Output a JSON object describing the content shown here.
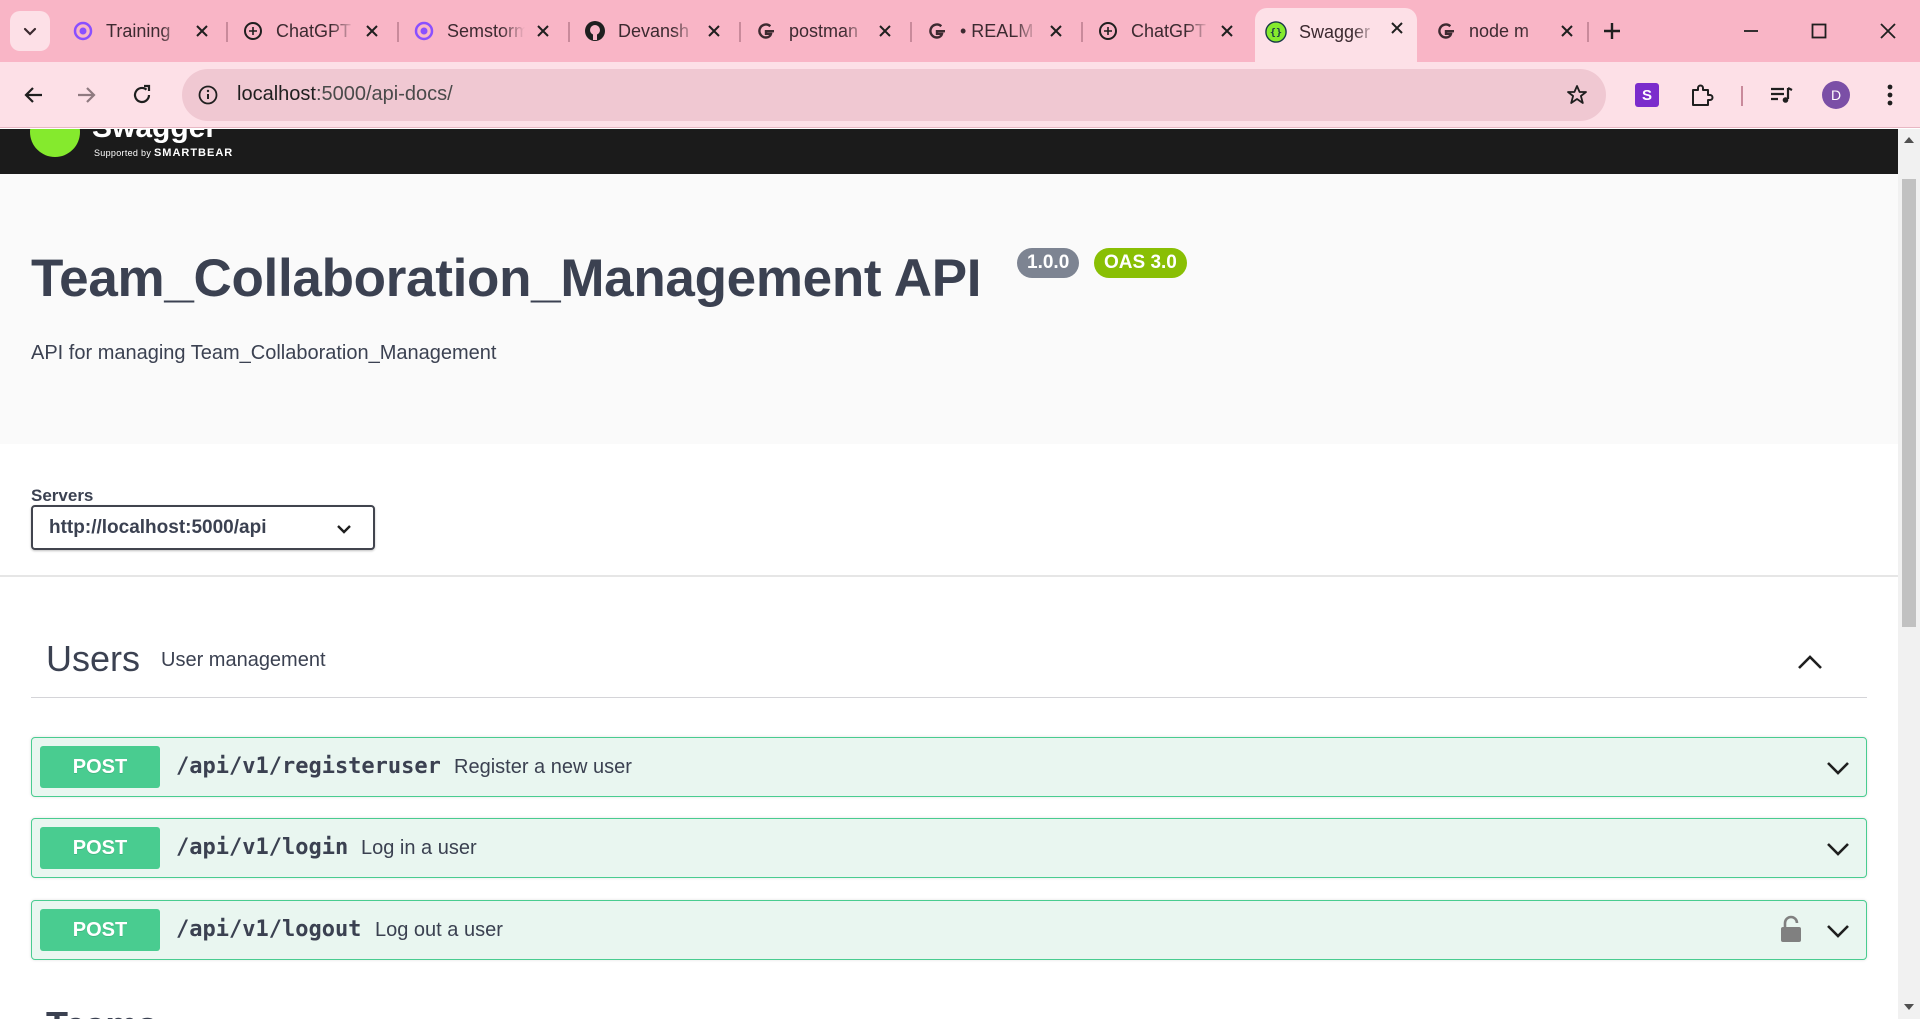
{
  "browser": {
    "tabs": [
      {
        "title": "Training",
        "icon": "semrush-icon"
      },
      {
        "title": "ChatGPT",
        "icon": "chatgpt-icon"
      },
      {
        "title": "Semstorm",
        "icon": "semrush-icon"
      },
      {
        "title": "Devansh",
        "icon": "github-icon"
      },
      {
        "title": "postman",
        "icon": "google-icon"
      },
      {
        "title": "• REALM",
        "icon": "google-icon"
      },
      {
        "title": "ChatGPT",
        "icon": "chatgpt-icon"
      },
      {
        "title": "Swagger",
        "icon": "swagger-icon",
        "active": true
      },
      {
        "title": "node m",
        "icon": "google-icon"
      }
    ],
    "url_host": "localhost",
    "url_path": ":5000/api-docs/",
    "extension_label": "S",
    "profile_initial": "D",
    "accent_tabbar": "#f9b5c6",
    "accent_toolbar": "#fde0e7"
  },
  "swagger": {
    "logo_word": "Swagger",
    "supported_prefix": "Supported by",
    "supported_brand": "SMARTBEAR",
    "title": "Team_Collaboration_Management API",
    "version": "1.0.0",
    "oas": "OAS 3.0",
    "description": "API for managing Team_Collaboration_Management",
    "servers_label": "Servers",
    "server_selected": "http://localhost:5000/api",
    "section": {
      "name": "Users",
      "description": "User management"
    },
    "operations": [
      {
        "method": "POST",
        "path": "/api/v1/registeruser",
        "summary": "Register a new user",
        "locked": false
      },
      {
        "method": "POST",
        "path": "/api/v1/login",
        "summary": "Log in a user",
        "locked": false
      },
      {
        "method": "POST",
        "path": "/api/v1/logout",
        "summary": "Log out a user",
        "locked": true
      }
    ],
    "next_section_partial": "Teams",
    "colors": {
      "post": "#49cc90",
      "post_bg": "#e9f6f0",
      "oas_badge": "#89bf04",
      "version_badge": "#7d8492"
    }
  }
}
